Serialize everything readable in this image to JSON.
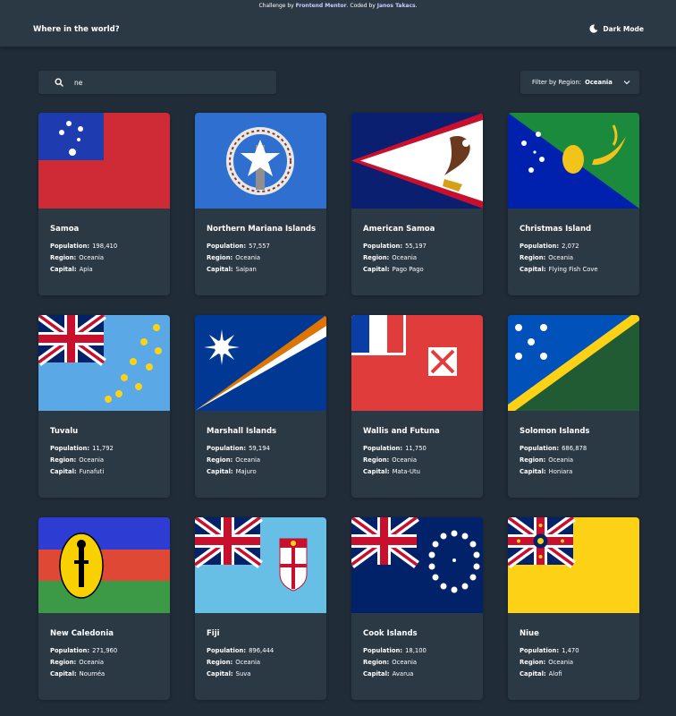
{
  "attribution": {
    "prefix": "Challenge by",
    "challenge_link": "Frontend Mentor",
    "middle": ". Coded by",
    "author_link": "Janos Takacs",
    "suffix": "."
  },
  "header": {
    "title": "Where in the world?",
    "theme_toggle_label": "Dark Mode",
    "theme_icon": "moon-icon"
  },
  "search": {
    "value": "ne",
    "icon": "search-icon"
  },
  "filter": {
    "label": "Filter by Region:",
    "value": "Oceania",
    "icon": "chevron-down-icon"
  },
  "labels": {
    "population": "Population:",
    "region": "Region:",
    "capital": "Capital:"
  },
  "colors": {
    "background": "#202c37",
    "surface": "#2b3945",
    "text": "#ffffff"
  },
  "countries": [
    {
      "name": "Samoa",
      "population": "198,410",
      "region": "Oceania",
      "capital": "Apia"
    },
    {
      "name": "Northern Mariana Islands",
      "population": "57,557",
      "region": "Oceania",
      "capital": "Saipan"
    },
    {
      "name": "American Samoa",
      "population": "55,197",
      "region": "Oceania",
      "capital": "Pago Pago"
    },
    {
      "name": "Christmas Island",
      "population": "2,072",
      "region": "Oceania",
      "capital": "Flying Fish Cove"
    },
    {
      "name": "Tuvalu",
      "population": "11,792",
      "region": "Oceania",
      "capital": "Funafuti"
    },
    {
      "name": "Marshall Islands",
      "population": "59,194",
      "region": "Oceania",
      "capital": "Majuro"
    },
    {
      "name": "Wallis and Futuna",
      "population": "11,750",
      "region": "Oceania",
      "capital": "Mata-Utu"
    },
    {
      "name": "Solomon Islands",
      "population": "686,878",
      "region": "Oceania",
      "capital": "Honiara"
    },
    {
      "name": "New Caledonia",
      "population": "271,960",
      "region": "Oceania",
      "capital": "Nouméa"
    },
    {
      "name": "Fiji",
      "population": "896,444",
      "region": "Oceania",
      "capital": "Suva"
    },
    {
      "name": "Cook Islands",
      "population": "18,100",
      "region": "Oceania",
      "capital": "Avarua"
    },
    {
      "name": "Niue",
      "population": "1,470",
      "region": "Oceania",
      "capital": "Alofi"
    }
  ]
}
